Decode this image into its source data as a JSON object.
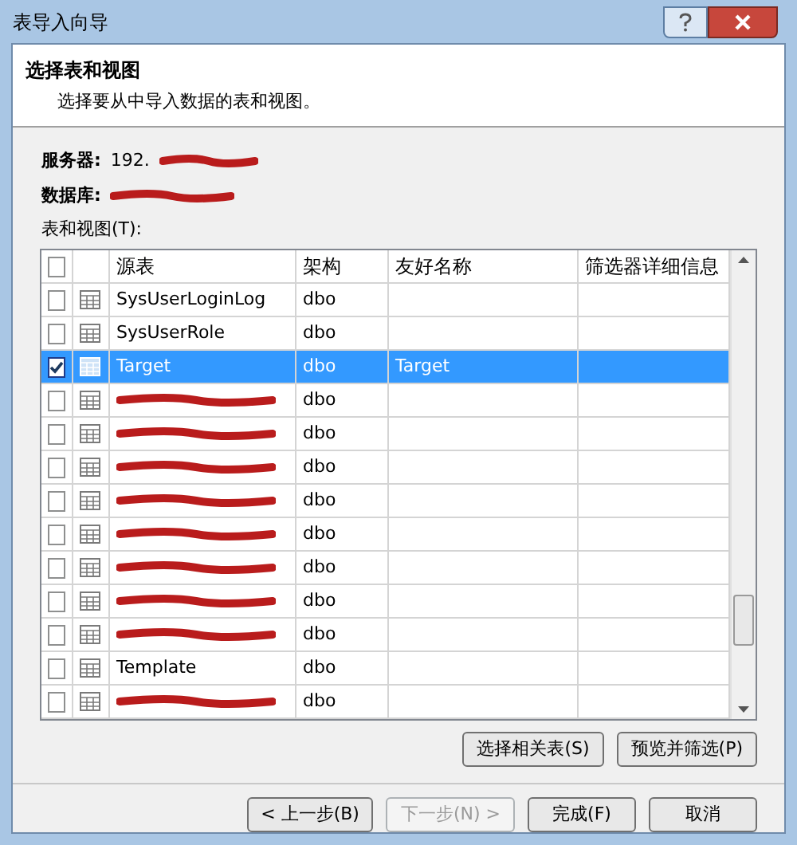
{
  "window": {
    "title": "表导入向导"
  },
  "header": {
    "title": "选择表和视图",
    "subtitle": "选择要从中导入数据的表和视图。"
  },
  "server": {
    "label": "服务器:",
    "value": "192.",
    "redacted": true
  },
  "database": {
    "label": "数据库:",
    "redacted": true
  },
  "list_label": "表和视图(T):",
  "table": {
    "header_checked": false,
    "columns": [
      "源表",
      "架构",
      "友好名称",
      "筛选器详细信息"
    ],
    "rows": [
      {
        "checked": false,
        "selected": false,
        "source": "SysUserLoginLog",
        "schema": "dbo"
      },
      {
        "checked": false,
        "selected": false,
        "source": "SysUserRole",
        "schema": "dbo"
      },
      {
        "checked": true,
        "selected": true,
        "source": "Target",
        "schema": "dbo",
        "friendly": "Target"
      },
      {
        "checked": false,
        "selected": false,
        "redacted": true,
        "schema": "dbo"
      },
      {
        "checked": false,
        "selected": false,
        "redacted": true,
        "schema": "dbo"
      },
      {
        "checked": false,
        "selected": false,
        "redacted": true,
        "schema": "dbo"
      },
      {
        "checked": false,
        "selected": false,
        "redacted": true,
        "schema": "dbo"
      },
      {
        "checked": false,
        "selected": false,
        "redacted": true,
        "schema": "dbo"
      },
      {
        "checked": false,
        "selected": false,
        "redacted": true,
        "schema": "dbo"
      },
      {
        "checked": false,
        "selected": false,
        "redacted": true,
        "schema": "dbo"
      },
      {
        "checked": false,
        "selected": false,
        "redacted": true,
        "schema": "dbo"
      },
      {
        "checked": false,
        "selected": false,
        "source": "Template",
        "schema": "dbo"
      },
      {
        "checked": false,
        "selected": false,
        "redacted": true,
        "schema": "dbo"
      }
    ]
  },
  "action_buttons": [
    "选择相关表(S)",
    "预览并筛选(P)"
  ],
  "nav_buttons": [
    {
      "label": "< 上一步(B)",
      "disabled": false
    },
    {
      "label": "下一步(N) >",
      "disabled": true
    },
    {
      "label": "完成(F)",
      "disabled": false
    },
    {
      "label": "取消",
      "disabled": false
    }
  ]
}
